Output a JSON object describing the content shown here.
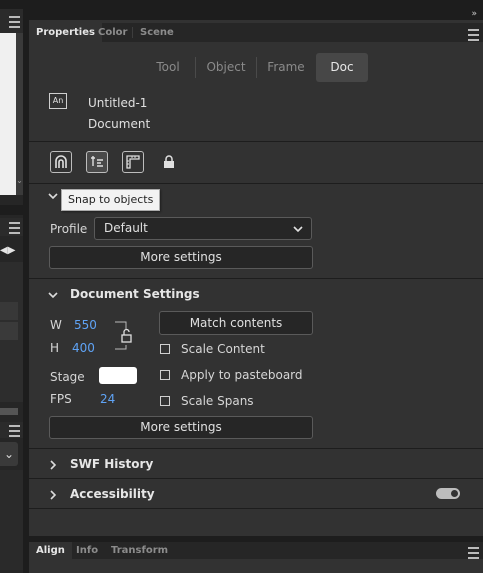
{
  "window": {
    "collapse_glyph": "»"
  },
  "tabs": [
    {
      "label": "Properties",
      "active": true
    },
    {
      "label": "Color",
      "active": false
    },
    {
      "label": "Scene",
      "active": false
    }
  ],
  "segments": {
    "tool": "Tool",
    "object": "Object",
    "frame": "Frame",
    "doc": "Doc",
    "active": "Doc"
  },
  "document": {
    "icon_text": "An",
    "name": "Untitled-1",
    "type": "Document"
  },
  "icon_row": [
    "magnet-icon",
    "snap-objects-icon",
    "ruler-guide-icon",
    "lock-icon"
  ],
  "tooltip": "Snap to objects",
  "profile": {
    "label": "Profile",
    "value": "Default",
    "more_settings": "More settings"
  },
  "doc_settings": {
    "title": "Document Settings",
    "w_label": "W",
    "w_value": "550",
    "h_label": "H",
    "h_value": "400",
    "match_contents": "Match contents",
    "scale_content": "Scale Content",
    "stage_label": "Stage",
    "stage_color": "#ffffff",
    "apply_pasteboard": "Apply to pasteboard",
    "fps_label": "FPS",
    "fps_value": "24",
    "scale_spans": "Scale Spans",
    "more_settings": "More settings"
  },
  "sections": {
    "swf_history": "SWF History",
    "accessibility": "Accessibility"
  },
  "bottom_tabs": [
    {
      "label": "Align",
      "active": true
    },
    {
      "label": "Info",
      "active": false
    },
    {
      "label": "Transform",
      "active": false
    }
  ],
  "colors": {
    "accent_value": "#5fa3f5",
    "panel_bg": "#323232",
    "active_segment": "#474747"
  }
}
